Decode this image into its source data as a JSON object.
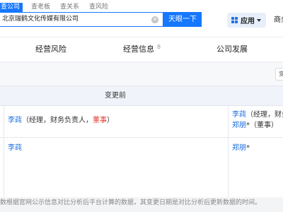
{
  "search_tabs": [
    "查公司",
    "查老板",
    "查关系",
    "查风险"
  ],
  "search": {
    "value": "北京瑞鹤文化传媒有限公司",
    "button_label": "天眼一下"
  },
  "header": {
    "app_label": "应用",
    "business_label": "商务"
  },
  "nav": {
    "items": [
      {
        "label": "经营风险",
        "count": ""
      },
      {
        "label": "经营信息",
        "count": "8"
      },
      {
        "label": "公司发展",
        "count": ""
      }
    ]
  },
  "filter": {
    "button_label": "变"
  },
  "table": {
    "header_before": "变更前",
    "row1": {
      "before_name": "李莼",
      "before_roles_plain": "（经理，财务负责人，",
      "before_roles_red": "董事",
      "before_roles_end": "）",
      "after_name1": "李莼",
      "after_roles1": "（经理，财务",
      "after_name2": "郑朋",
      "after_star": "*",
      "after_roles2": "（董事）"
    },
    "row2": {
      "before_name": "李莼",
      "after_name": "郑朋",
      "after_star": "*"
    }
  },
  "footer_note": "数根据官网公示信息对比分析后平台计算的数据，其变更日期是对比分析后更新数据的时间。",
  "colors": {
    "accent": "#1677ff",
    "link": "#1d6fe0",
    "highlight_red": "#e03a2f"
  }
}
